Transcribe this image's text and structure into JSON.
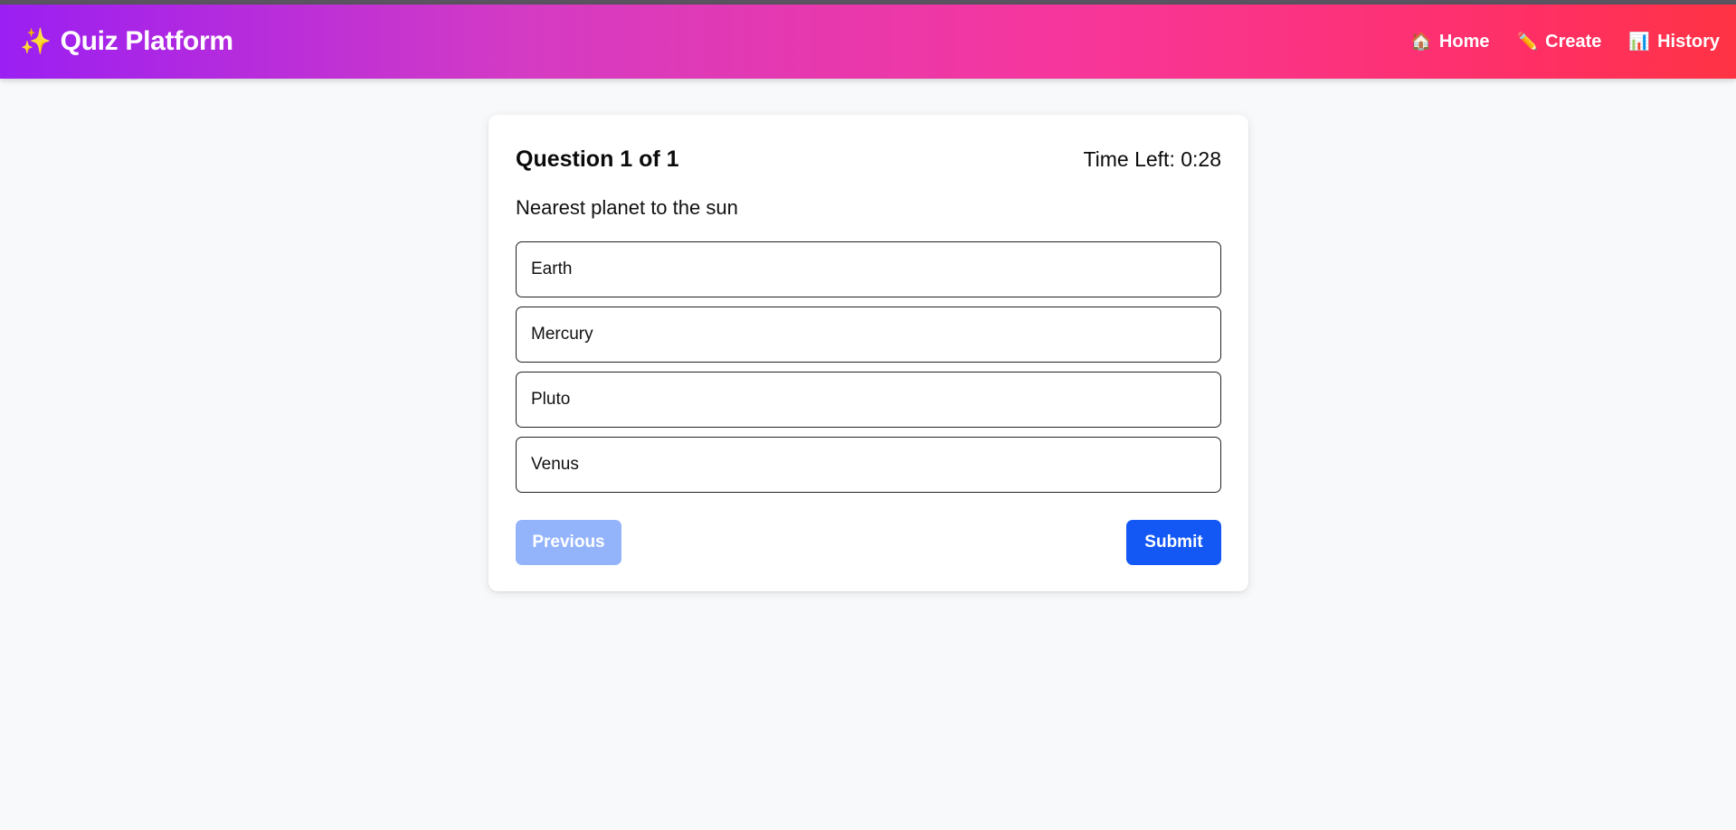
{
  "app": {
    "brand_icon": "sparkles-icon",
    "brand_icon_glyph": "✨",
    "brand_label": "Quiz Platform"
  },
  "nav": {
    "items": [
      {
        "icon": "house-icon",
        "glyph": "🏠",
        "label": "Home"
      },
      {
        "icon": "pencil-icon",
        "glyph": "✏️",
        "label": "Create"
      },
      {
        "icon": "bar-chart-icon",
        "glyph": "📊",
        "label": "History"
      }
    ]
  },
  "quiz": {
    "question_counter": "Question 1 of 1",
    "timer": "Time Left: 0:28",
    "question_text": "Nearest planet to the sun",
    "options": [
      "Earth",
      "Mercury",
      "Pluto",
      "Venus"
    ],
    "previous_label": "Previous",
    "submit_label": "Submit"
  },
  "colors": {
    "gradient_start": "#9b1ff2",
    "gradient_end": "#ff3344",
    "primary_button": "#1358f5",
    "disabled_button": "#93b3fb",
    "page_background": "#f8f9fb"
  }
}
